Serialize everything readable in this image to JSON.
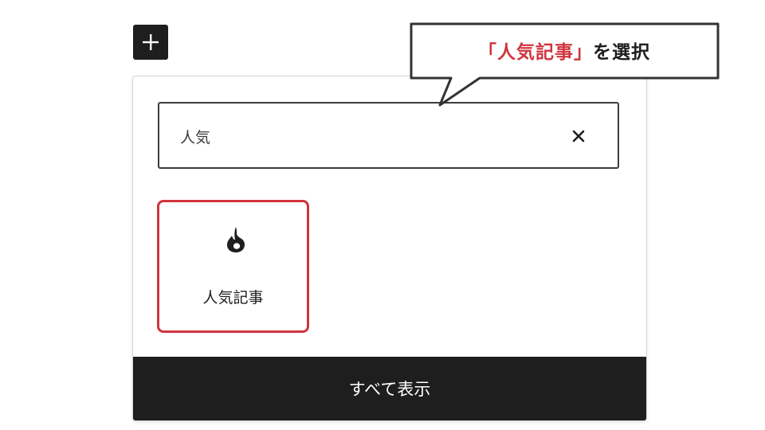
{
  "inserter": {
    "add_button_icon": "plus-icon"
  },
  "search": {
    "value": "人気",
    "clear_icon": "close-icon"
  },
  "results": [
    {
      "label": "人気記事",
      "icon": "flame-icon"
    }
  ],
  "footer": {
    "show_all_label": "すべて表示"
  },
  "callout": {
    "highlight": "「人気記事」",
    "text": "を選択"
  },
  "colors": {
    "dark": "#1e1e1e",
    "highlight_red": "#d0343d",
    "border": "#3c3c3c"
  }
}
